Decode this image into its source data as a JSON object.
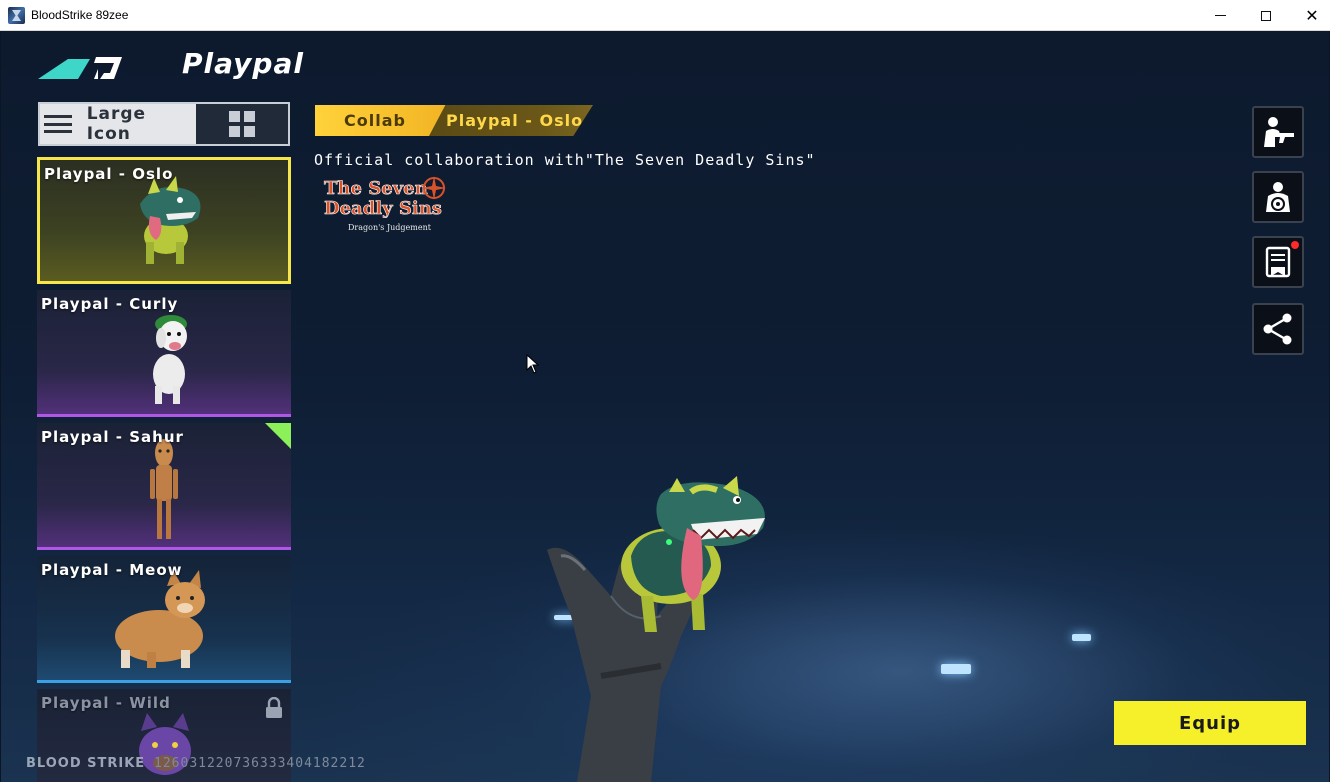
{
  "window": {
    "title": "BloodStrike 89zee",
    "controls": [
      "minimize",
      "maximize",
      "close"
    ]
  },
  "header": {
    "logo_icon": "bloodstrike-logo-icon",
    "title": "Playpal"
  },
  "view_toggle": {
    "large_icon_label": "Large Icon",
    "large_icon_active": true,
    "grid_icon": "grid-icon"
  },
  "items": [
    {
      "label": "Playpal - Oslo",
      "rarity_color": "#f6e64a",
      "selected": true,
      "locked": false,
      "new": false
    },
    {
      "label": "Playpal - Curly",
      "rarity_color": "#b057e8",
      "selected": false,
      "locked": false,
      "new": false
    },
    {
      "label": "Playpal - Sahur",
      "rarity_color": "#b057e8",
      "selected": false,
      "locked": false,
      "new": true
    },
    {
      "label": "Playpal - Meow",
      "rarity_color": "#3aa0e8",
      "selected": false,
      "locked": false,
      "new": false
    },
    {
      "label": "Playpal - Wild",
      "rarity_color": "#8b93a3",
      "selected": false,
      "locked": true,
      "new": false
    }
  ],
  "detail": {
    "tag_type": "Collab",
    "tag_name": "Playpal - Oslo",
    "description": "Official collaboration with\"The Seven Deadly Sins\"",
    "collab_logo": {
      "line1": "The Seven",
      "line2": "Deadly Sins",
      "line3": "Dragon's Judgement"
    }
  },
  "side_buttons": [
    {
      "icon": "character-with-gun-icon",
      "notification": false
    },
    {
      "icon": "shooting-target-icon",
      "notification": false
    },
    {
      "icon": "book-icon",
      "notification": true
    },
    {
      "icon": "share-icon",
      "notification": false
    }
  ],
  "equip_label": "Equip",
  "footer": {
    "game_name": "BLOOD STRIKE",
    "player_id": "126031220736333404182212"
  },
  "colors": {
    "accent_yellow": "#f5f02a",
    "collab_tag": "#ffd23a",
    "epic_purple": "#b057e8",
    "rare_blue": "#3aa0e8"
  }
}
